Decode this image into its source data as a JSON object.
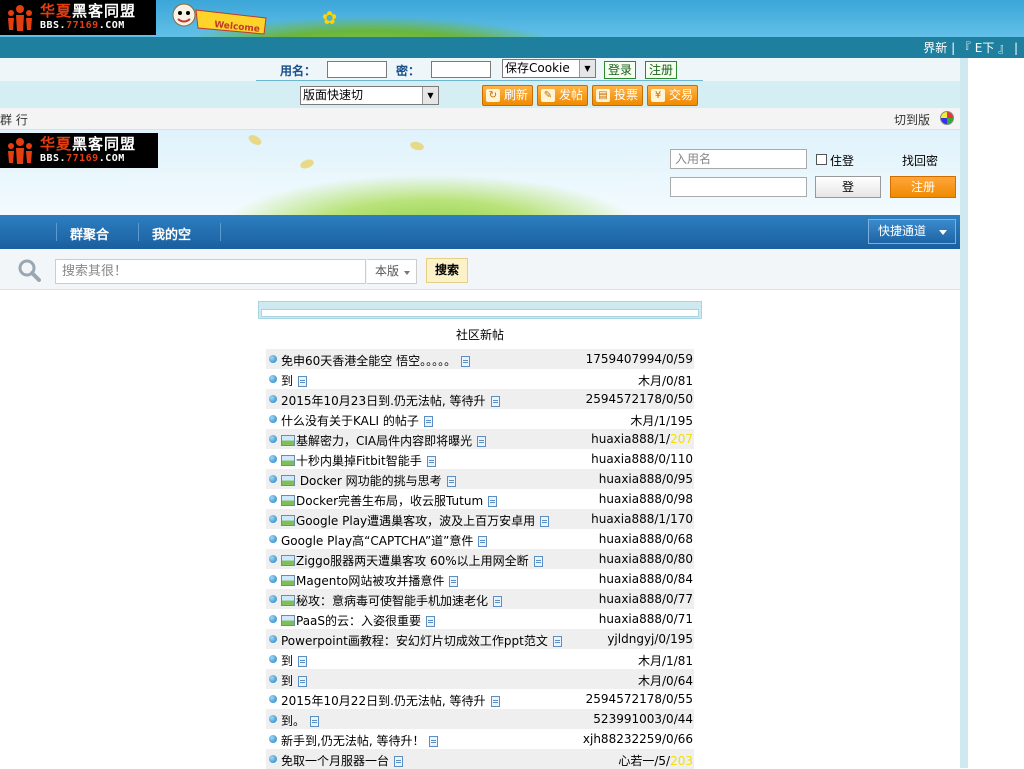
{
  "top_banner": {
    "logo_cn_red": "华夏",
    "logo_cn_white": "黑客同盟",
    "logo_en_a": "BBS.",
    "logo_en_b": "77169",
    "logo_en_c": ".COM",
    "welcome_text": "Welcome"
  },
  "top_links": {
    "text": "界新 | 『 E下 』 |"
  },
  "login": {
    "username_label": "用名：",
    "password_label": "密：",
    "cookie_select": "保存Cookie",
    "login_button": "登录",
    "register_button": "注册"
  },
  "toolbar": {
    "board_select": "版面快速切",
    "refresh": "刷新",
    "post": "发帖",
    "vote": "投票",
    "trade": "交易"
  },
  "group_bar": {
    "left": "群  行",
    "right": "切到版"
  },
  "hero": {
    "username_placeholder": "入用名",
    "remember_label": "住登",
    "forgot_password": "找回密",
    "login_button": "登",
    "register_button": "注册"
  },
  "nav": {
    "items": [
      "",
      "群聚合",
      "我的空",
      ""
    ],
    "quick_access": "快捷通道"
  },
  "search": {
    "placeholder": "搜索其很！",
    "scope": "本版",
    "button": "搜索"
  },
  "panel": {
    "title": "社区新帖",
    "rows": [
      {
        "title": "免申60天香港全能空 悟空。。。。。",
        "stats": "1759407994/0/59",
        "hot": "",
        "image": false
      },
      {
        "title": "到",
        "stats": "木月/0/81",
        "hot": "",
        "image": false
      },
      {
        "title": "2015年10月23日到.仍无法帖, 等待升",
        "stats": "2594572178/0/50",
        "hot": "",
        "image": false
      },
      {
        "title": "什么没有关于KALI 的帖子",
        "stats": "木月/1/195",
        "hot": "",
        "image": false
      },
      {
        "title": "基解密力，CIA局件内容即将曝光",
        "stats": "huaxia888/1/",
        "hot": "207",
        "image": true
      },
      {
        "title": "十秒内巢掉Fitbit智能手",
        "stats": "huaxia888/0/110",
        "hot": "",
        "image": true
      },
      {
        "title": " Docker 网功能的挑与思考",
        "stats": "huaxia888/0/95",
        "hot": "",
        "image": true
      },
      {
        "title": "Docker完善生布局，收云服Tutum",
        "stats": "huaxia888/0/98",
        "hot": "",
        "image": true
      },
      {
        "title": "Google Play遭遇巢客攻，波及上百万安卓用",
        "stats": "huaxia888/1/170",
        "hot": "",
        "image": true
      },
      {
        "title": "Google Play高“CAPTCHA”道”意件",
        "stats": "huaxia888/0/68",
        "hot": "",
        "image": false
      },
      {
        "title": "Ziggo服器两天遭巢客攻 60%以上用网全断",
        "stats": "huaxia888/0/80",
        "hot": "",
        "image": true
      },
      {
        "title": "Magento网站被攻并播意件",
        "stats": "huaxia888/0/84",
        "hot": "",
        "image": true
      },
      {
        "title": "秘攻：意病毒可使智能手机加速老化",
        "stats": "huaxia888/0/77",
        "hot": "",
        "image": true
      },
      {
        "title": "PaaS的云：入姿很重要",
        "stats": "huaxia888/0/71",
        "hot": "",
        "image": true
      },
      {
        "title": "Powerpoint画教程：安幻灯片切成效工作ppt范文",
        "stats": "yjldngyj/0/195",
        "hot": "",
        "image": false
      },
      {
        "title": "到",
        "stats": "木月/1/81",
        "hot": "",
        "image": false
      },
      {
        "title": "到",
        "stats": "木月/0/64",
        "hot": "",
        "image": false
      },
      {
        "title": "2015年10月22日到.仍无法帖, 等待升",
        "stats": "2594572178/0/55",
        "hot": "",
        "image": false
      },
      {
        "title": "到。",
        "stats": "523991003/0/44",
        "hot": "",
        "image": false
      },
      {
        "title": "新手到,仍无法帖, 等待升！",
        "stats": "xjh88232259/0/66",
        "hot": "",
        "image": false
      },
      {
        "title": "免取一个月服器一台",
        "stats": "心若一/5/",
        "hot": "203",
        "image": false
      }
    ]
  },
  "colors": {
    "banner": "#3ba6d8",
    "darkbar": "#1f7f9f",
    "nav": "#1a5fa0",
    "accent_orange": "#f08a00",
    "hot": "#f3e000"
  }
}
